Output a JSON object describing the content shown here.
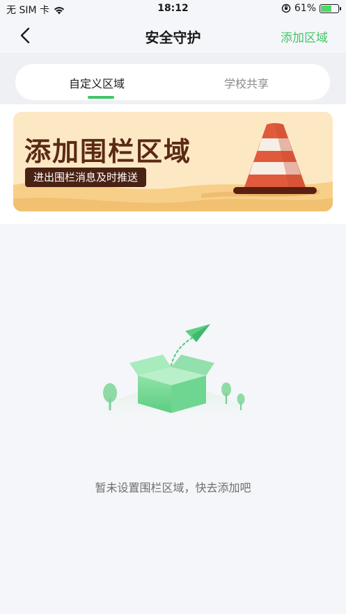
{
  "status_bar": {
    "carrier": "无 SIM 卡",
    "time": "18:12",
    "battery_percent": "61%",
    "battery_level": 0.61,
    "icons": [
      "wifi-icon",
      "orientation-lock-icon",
      "battery-icon"
    ]
  },
  "nav": {
    "title": "安全守护",
    "action": "添加区域",
    "back_icon": "chevron-left-icon"
  },
  "tabs": [
    {
      "label": "自定义区域",
      "active": true
    },
    {
      "label": "学校共享",
      "active": false
    }
  ],
  "banner": {
    "title": "添加围栏区域",
    "subtitle": "进出围栏消息及时推送",
    "image": "traffic-cone-icon"
  },
  "empty_state": {
    "text": "暂未设置围栏区域，快去添加吧",
    "illustration": "empty-box-icon"
  },
  "colors": {
    "accent": "#3fc766",
    "background": "#f5f6f9",
    "banner_text": "#5a2a14"
  }
}
